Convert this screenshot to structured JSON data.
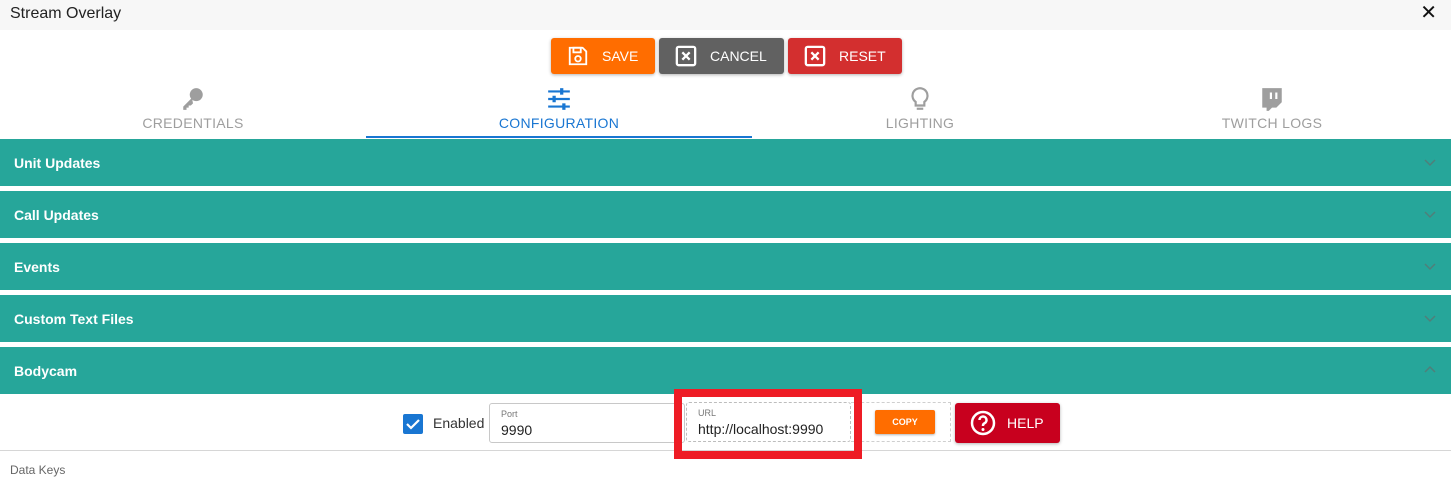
{
  "window": {
    "title": "Stream Overlay",
    "close_glyph": "✕"
  },
  "toolbar": {
    "save_label": "SAVE",
    "cancel_label": "CANCEL",
    "reset_label": "RESET",
    "save_color": "#ff6d00",
    "cancel_color": "#616161",
    "reset_color": "#d32f2f"
  },
  "tabs": [
    {
      "label": "CREDENTIALS",
      "icon": "key-icon",
      "active": false
    },
    {
      "label": "CONFIGURATION",
      "icon": "sliders-icon",
      "active": true
    },
    {
      "label": "LIGHTING",
      "icon": "lightbulb-icon",
      "active": false
    },
    {
      "label": "TWITCH LOGS",
      "icon": "twitch-icon",
      "active": false
    }
  ],
  "panels": [
    {
      "label": "Unit Updates",
      "expanded": false
    },
    {
      "label": "Call Updates",
      "expanded": false
    },
    {
      "label": "Events",
      "expanded": false
    },
    {
      "label": "Custom Text Files",
      "expanded": false
    },
    {
      "label": "Bodycam",
      "expanded": true
    }
  ],
  "bodycam": {
    "enabled_label": "Enabled",
    "enabled": true,
    "port_label": "Port",
    "port_value": "9990",
    "url_label": "URL",
    "url_value": "http://localhost:9990",
    "copy_label": "COPY",
    "help_label": "HELP"
  },
  "footer": {
    "data_keys_label": "Data Keys"
  },
  "colors": {
    "accent": "#1976d2",
    "panel": "#26a69a",
    "highlight": "#ee1c25",
    "help": "#c8001e"
  }
}
